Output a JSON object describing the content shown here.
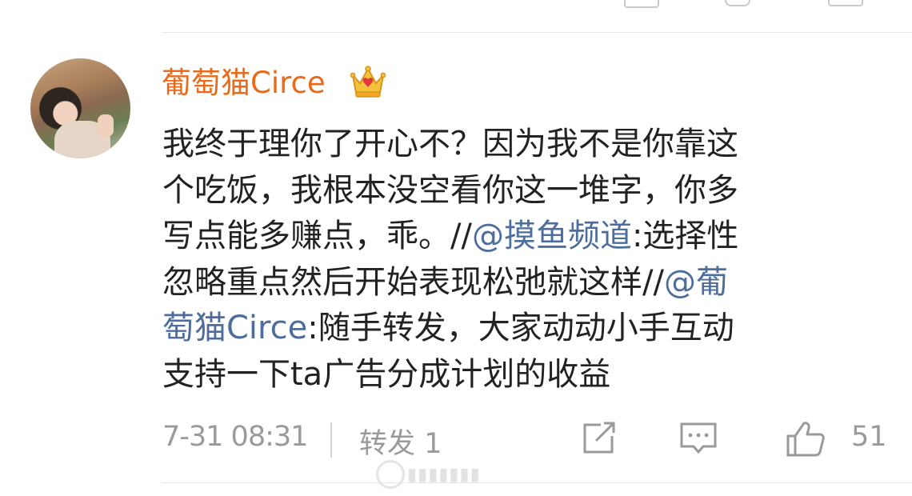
{
  "comment": {
    "username": "葡萄猫Circe",
    "badge_icon": "crown-icon",
    "content_lines": [
      {
        "parts": [
          {
            "text": "我终于理你了开心不？因为我不是你靠这",
            "type": "text"
          }
        ]
      },
      {
        "parts": [
          {
            "text": "个吃饭，我根本没空看你这一堆字，你多",
            "type": "text"
          }
        ]
      },
      {
        "parts": [
          {
            "text": "写点能多赚点，乖。//",
            "type": "text"
          },
          {
            "text": "@摸鱼频道",
            "type": "mention"
          },
          {
            "text": ":选择性",
            "type": "text"
          }
        ]
      },
      {
        "parts": [
          {
            "text": "忽略重点然后开始表现松弛就这样//",
            "type": "text"
          },
          {
            "text": "@葡",
            "type": "mention"
          }
        ]
      },
      {
        "parts": [
          {
            "text": "萄猫Circe",
            "type": "mention"
          },
          {
            "text": ":随手转发，大家动动小手互动",
            "type": "text"
          }
        ]
      },
      {
        "parts": [
          {
            "text": "支持一下ta广告分成计划的收益",
            "type": "text"
          }
        ]
      }
    ],
    "timestamp": "7-31 08:31",
    "repost_label": "转发 1",
    "like_count": "51"
  },
  "colors": {
    "username": "#e86a1a",
    "mention": "#4d6e9c",
    "text": "#222222",
    "meta": "#9a9a9a"
  },
  "icons": [
    "crown-icon",
    "share-icon",
    "comment-icon",
    "like-icon"
  ]
}
